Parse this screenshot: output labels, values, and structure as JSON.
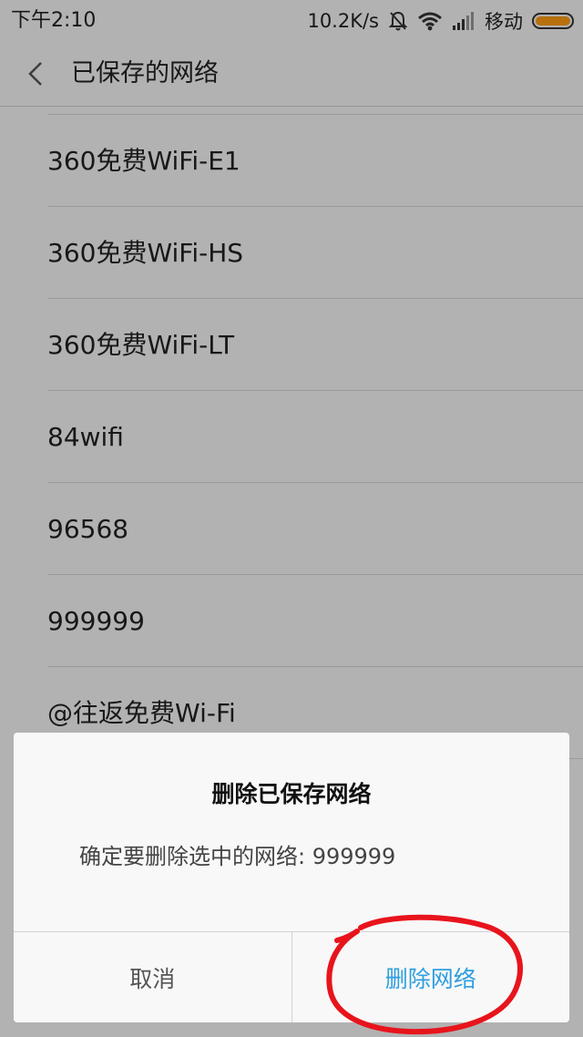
{
  "status_bar": {
    "time": "下午2:10",
    "speed": "10.2K/s",
    "carrier": "移动",
    "icons": [
      "mute-bell-icon",
      "wifi-icon",
      "signal-icon",
      "battery-icon"
    ],
    "battery_color": "#ff9c12"
  },
  "header": {
    "back_icon": "chevron-left-icon",
    "title": "已保存的网络"
  },
  "networks": [
    "360免费WiFi-E1",
    "360免费WiFi-HS",
    "360免费WiFi-LT",
    "84wifi",
    "96568",
    "999999",
    "@往返免费Wi-Fi"
  ],
  "dialog": {
    "title": "删除已保存网络",
    "message": "确定要删除选中的网络: 999999",
    "cancel_label": "取消",
    "confirm_label": "删除网络",
    "confirm_color": "#2d9ee0"
  },
  "annotation": {
    "color": "#e8141c",
    "shape": "hand-drawn-circle"
  }
}
